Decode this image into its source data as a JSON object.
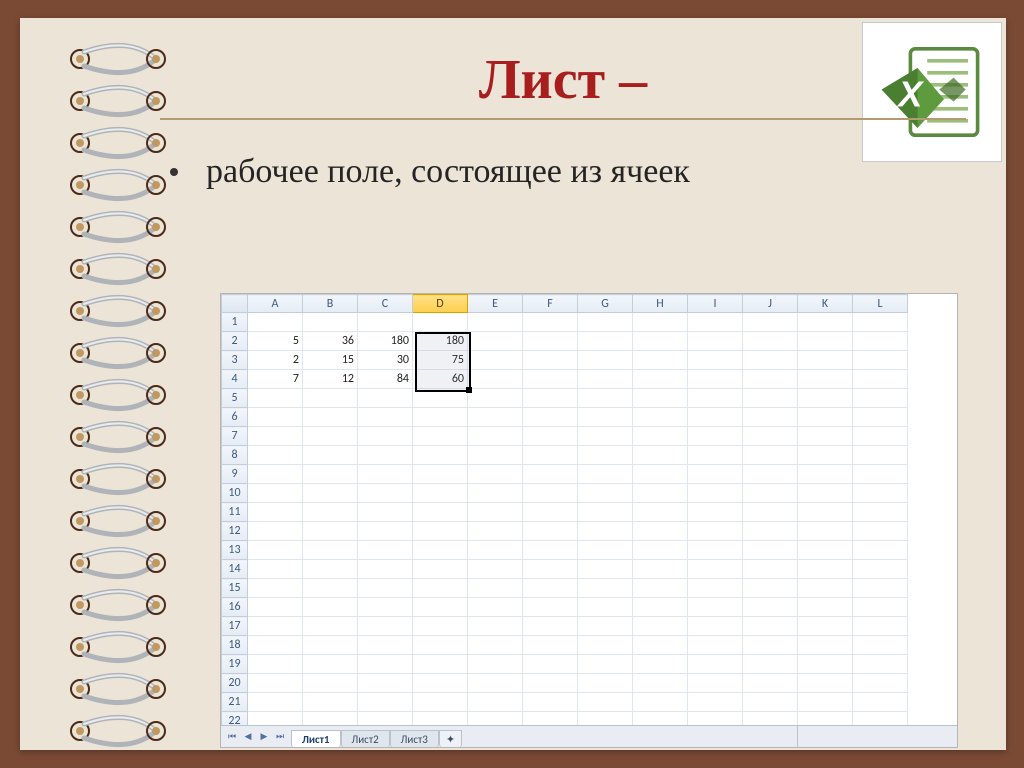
{
  "title": "Лист –",
  "bullet": "рабочее поле, состоящее из ячеек",
  "columns": [
    "A",
    "B",
    "C",
    "D",
    "E",
    "F",
    "G",
    "H",
    "I",
    "J",
    "K",
    "L"
  ],
  "active_column": "D",
  "rows": 22,
  "data": {
    "2": {
      "A": 5,
      "B": 36,
      "C": 180,
      "D": 180
    },
    "3": {
      "A": 2,
      "B": 15,
      "C": 30,
      "D": 75
    },
    "4": {
      "A": 7,
      "B": 12,
      "C": 84,
      "D": 60
    }
  },
  "selection": {
    "col_start": "D",
    "col_end": "D",
    "row_start": 2,
    "row_end": 4
  },
  "tabs": {
    "items": [
      "Лист1",
      "Лист2",
      "Лист3"
    ],
    "active": "Лист1"
  },
  "logo_alt": "excel-icon"
}
